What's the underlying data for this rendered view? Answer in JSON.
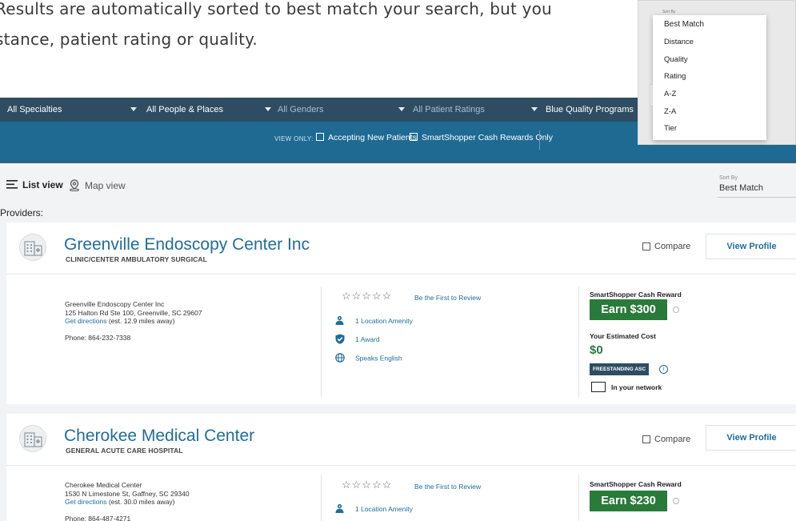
{
  "intro": {
    "line1": "Results are automatically sorted to best match your search, but you",
    "line2": "stance, patient rating or quality."
  },
  "filters": {
    "specialties": "All Specialties",
    "people_places": "All People & Places",
    "genders": "All Genders",
    "patient_ratings": "All Patient Ratings",
    "quality_programs": "Blue Quality Programs"
  },
  "view_only": {
    "label": "VIEW ONLY:",
    "accepting_new_patients": "Accepting New Patients",
    "smartshopper_only": "SmartShopper Cash Rewards Only"
  },
  "toolbar": {
    "list_view": "List view",
    "map_view": "Map view",
    "sort_by_label": "Sort By",
    "sort_by_value": "Best Match",
    "providers_label": "Providers:"
  },
  "sort_dropdown": {
    "label": "Sort By",
    "options": [
      "Best Match",
      "Distance",
      "Quality",
      "Rating",
      "A-Z",
      "Z-A",
      "Tier"
    ]
  },
  "providers": [
    {
      "name": "Greenville Endoscopy Center Inc",
      "type": "CLINIC/CENTER AMBULATORY SURGICAL",
      "compare_label": "Compare",
      "view_profile": "View Profile",
      "address_name": "Greenville Endoscopy Center Inc",
      "address_street": "125 Halton Rd Ste 100, Greenville, SC 29607",
      "directions_link": "Get directions",
      "directions_distance": "(est. 12.9 miles away)",
      "phone": "Phone: 864-232-7338",
      "stars": "☆☆☆☆☆",
      "review_link": "Be the First to Review",
      "amenity": "1 Location Amenity",
      "award": "1 Award",
      "language": "Speaks English",
      "reward_label": "SmartShopper Cash Reward",
      "reward_button": "Earn $300",
      "cost_label": "Your Estimated Cost",
      "cost_value": "$0",
      "badge": "FREESTANDING ASC",
      "network": "In your network"
    },
    {
      "name": "Cherokee Medical Center",
      "type": "GENERAL ACUTE CARE HOSPITAL",
      "compare_label": "Compare",
      "view_profile": "View Profile",
      "address_name": "Cherokee Medical Center",
      "address_street": "1530 N Limestone St, Gaffney, SC 29340",
      "directions_link": "Get directions",
      "directions_distance": "(est. 30.0 miles away)",
      "phone": "Phone: 864-487-4271",
      "stars": "☆☆☆☆☆",
      "review_link": "Be the First to Review",
      "amenity": "1 Location Amenity",
      "reward_label": "SmartShopper Cash Reward",
      "reward_button": "Earn $230"
    }
  ],
  "colors": {
    "filter_bar": "#2e4d63",
    "view_only_bar": "#1f6a93",
    "link_blue": "#1f6e98",
    "reward_green": "#2a7a3a"
  }
}
